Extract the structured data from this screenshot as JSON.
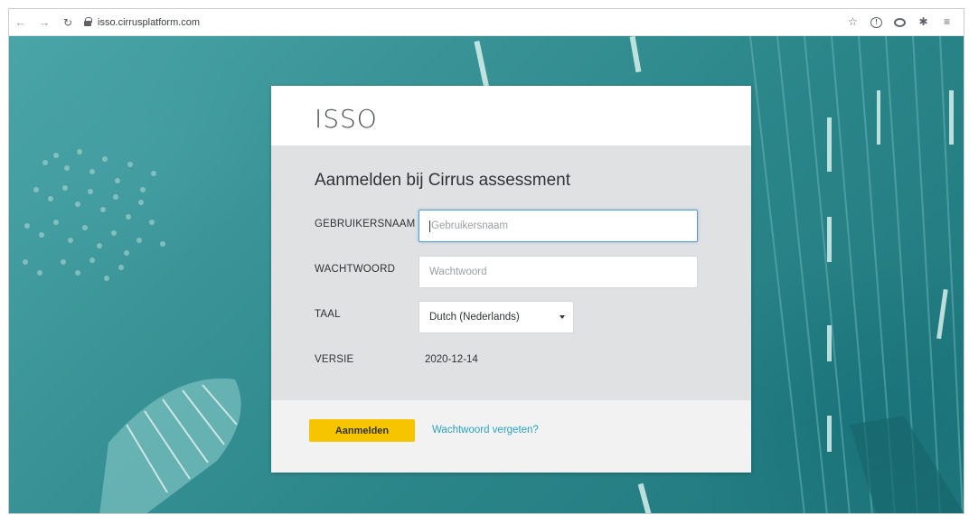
{
  "browser": {
    "url": "isso.cirrusplatform.com",
    "nav_icons": [
      "back-arrow-icon",
      "forward-arrow-icon",
      "reload-icon"
    ],
    "right_icons": [
      "star-icon",
      "info-extension-icon",
      "circle-extension-icon",
      "puzzle-icon",
      "reading-list-icon"
    ]
  },
  "card": {
    "brand": "ISSO",
    "title": "Aanmelden bij Cirrus assessment",
    "username": {
      "label": "GEBRUIKERSNAAM",
      "placeholder": "Gebruikersnaam",
      "value": ""
    },
    "password": {
      "label": "WACHTWOORD",
      "placeholder": "Wachtwoord",
      "value": ""
    },
    "language": {
      "label": "TAAL",
      "selected": "Dutch (Nederlands)"
    },
    "version": {
      "label": "VERSIE",
      "value": "2020-12-14"
    },
    "login_button": "Aanmelden",
    "forgot_link": "Wachtwoord vergeten?"
  },
  "colors": {
    "accent_button": "#f7c500",
    "link": "#2aa3c4",
    "focus_border": "#5b9bd5",
    "background_teal": "#2a8589"
  }
}
